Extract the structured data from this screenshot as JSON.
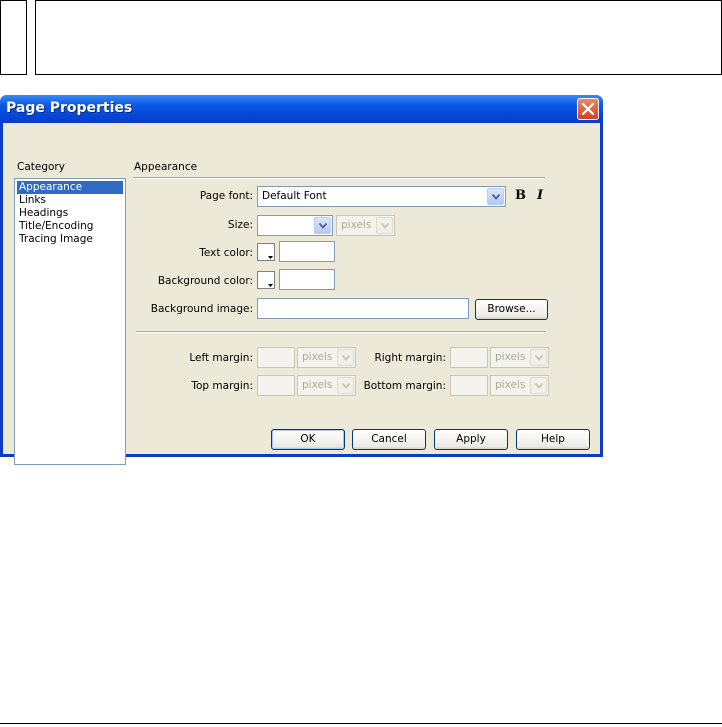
{
  "dialog": {
    "title": "Page Properties",
    "close_label": "Close"
  },
  "category": {
    "label": "Category",
    "items": [
      "Appearance",
      "Links",
      "Headings",
      "Title/Encoding",
      "Tracing Image"
    ],
    "selected": "Appearance"
  },
  "appearance": {
    "section_title": "Appearance",
    "page_font_label": "Page font:",
    "page_font_value": "Default Font",
    "bold_label": "B",
    "italic_label": "I",
    "size_label": "Size:",
    "size_value": "",
    "size_unit": "pixels",
    "text_color_label": "Text color:",
    "text_color_value": "",
    "bg_color_label": "Background color:",
    "bg_color_value": "",
    "bg_image_label": "Background image:",
    "bg_image_value": "",
    "browse_label": "Browse...",
    "left_margin_label": "Left margin:",
    "right_margin_label": "Right margin:",
    "top_margin_label": "Top margin:",
    "bottom_margin_label": "Bottom margin:",
    "margin_unit": "pixels"
  },
  "buttons": {
    "ok": "OK",
    "cancel": "Cancel",
    "apply": "Apply",
    "help": "Help"
  },
  "colors": {
    "titlebar": "#0a3cc8",
    "dialog_bg": "#ece9d8",
    "selection": "#316ac5",
    "close_button": "#d5401c"
  }
}
